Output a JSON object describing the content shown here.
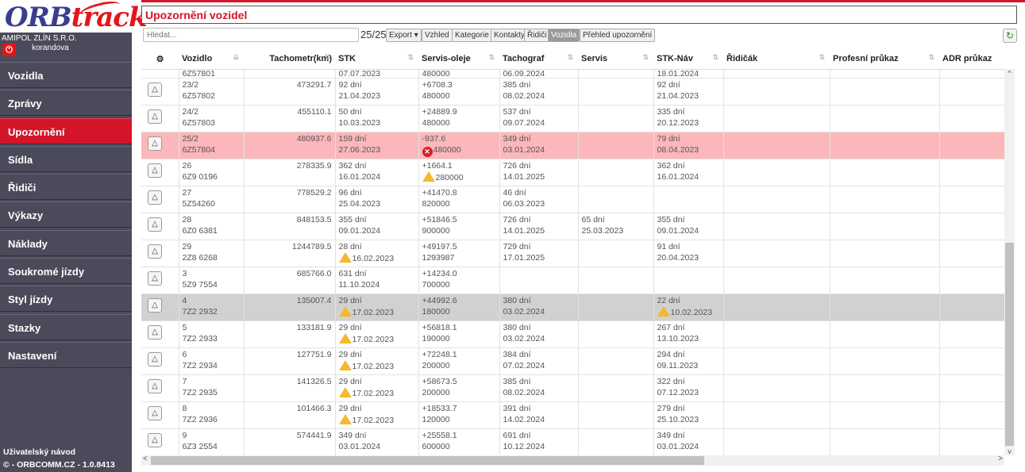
{
  "sidebar": {
    "logo_main": "ORB",
    "logo_accent": "track",
    "company": "AMIPOL ZLÍN S.R.O.",
    "user": "korandova",
    "items": [
      {
        "label": "Vozidla"
      },
      {
        "label": "Zprávy"
      },
      {
        "label": "Upozornění"
      },
      {
        "label": "Sídla"
      },
      {
        "label": "Řidiči"
      },
      {
        "label": "Výkazy"
      },
      {
        "label": "Náklady"
      },
      {
        "label": "Soukromé jízdy"
      },
      {
        "label": "Styl jízdy"
      },
      {
        "label": "Stazky"
      },
      {
        "label": "Nastavení"
      }
    ],
    "active_item": "Upozornění",
    "footer_help": "Uživatelský návod",
    "footer_version": "© - ORBCOMM.CZ - 1.0.8413"
  },
  "header": {
    "title": "Upozornění vozidel"
  },
  "toolbar": {
    "search_placeholder": "Hledat...",
    "count": "25/25",
    "export": "Export ▾",
    "view": "Vzhled",
    "kategorie": "Kategorie",
    "kontakty": "Kontakty",
    "ridici": "Řidiči",
    "vozidla": "Vozidla",
    "prehled": "Přehled upozornění"
  },
  "columns": [
    "Vozidlo",
    "Tachometr(km)",
    "STK",
    "Servis-oleje",
    "Tachograf",
    "Servis",
    "STK-Náv",
    "Řidičák",
    "Profesní průkaz",
    "ADR průkaz"
  ],
  "partial_row": {
    "vozidlo": "6Z57801",
    "stk": "07.07.2023",
    "servis": "480000",
    "tacho": "06.09.2024",
    "nav": "18.01.2024"
  },
  "rows": [
    {
      "v1": "23/2",
      "v2": "6Z57802",
      "km": "473291.7",
      "stk1": "92 dní",
      "stk2": "21.04.2023",
      "stk_warn": false,
      "s1": "+6708.3",
      "s2": "480000",
      "s_warn": "",
      "t1": "385 dní",
      "t2": "08.02.2024",
      "sv1": "",
      "sv2": "",
      "n1": "92 dní",
      "n2": "21.04.2023",
      "n_warn": false,
      "style": ""
    },
    {
      "v1": "24/2",
      "v2": "6Z57803",
      "km": "455110.1",
      "stk1": "50 dní",
      "stk2": "10.03.2023",
      "stk_warn": false,
      "s1": "+24889.9",
      "s2": "480000",
      "s_warn": "",
      "t1": "537 dní",
      "t2": "09.07.2024",
      "sv1": "",
      "sv2": "",
      "n1": "335 dní",
      "n2": "20.12.2023",
      "n_warn": false,
      "style": ""
    },
    {
      "v1": "25/2",
      "v2": "6Z57804",
      "km": "480937.6",
      "stk1": "159 dní",
      "stk2": "27.06.2023",
      "stk_warn": false,
      "s1": "-937.6",
      "s2": "480000",
      "s_warn": "err",
      "t1": "349 dní",
      "t2": "03.01.2024",
      "sv1": "",
      "sv2": "",
      "n1": "79 dní",
      "n2": "08.04.2023",
      "n_warn": false,
      "style": "red"
    },
    {
      "v1": "26",
      "v2": "6Z9 0196",
      "km": "278335.9",
      "stk1": "362 dní",
      "stk2": "16.01.2024",
      "stk_warn": false,
      "s1": "+1664.1",
      "s2": "280000",
      "s_warn": "warn",
      "t1": "726 dní",
      "t2": "14.01.2025",
      "sv1": "",
      "sv2": "",
      "n1": "362 dní",
      "n2": "16.01.2024",
      "n_warn": false,
      "style": ""
    },
    {
      "v1": "27",
      "v2": "5Z54260",
      "km": "778529.2",
      "stk1": "96 dní",
      "stk2": "25.04.2023",
      "stk_warn": false,
      "s1": "+41470.8",
      "s2": "820000",
      "s_warn": "",
      "t1": "46 dní",
      "t2": "06.03.2023",
      "sv1": "",
      "sv2": "",
      "n1": "",
      "n2": "",
      "n_warn": false,
      "style": ""
    },
    {
      "v1": "28",
      "v2": "6Z0 6381",
      "km": "848153.5",
      "stk1": "355 dní",
      "stk2": "09.01.2024",
      "stk_warn": false,
      "s1": "+51846.5",
      "s2": "900000",
      "s_warn": "",
      "t1": "726 dní",
      "t2": "14.01.2025",
      "sv1": "65 dní",
      "sv2": "25.03.2023",
      "n1": "355 dní",
      "n2": "09.01.2024",
      "n_warn": false,
      "style": ""
    },
    {
      "v1": "29",
      "v2": "2Z8 6268",
      "km": "1244789.5",
      "stk1": "28 dní",
      "stk2": "16.02.2023",
      "stk_warn": true,
      "s1": "+49197.5",
      "s2": "1293987",
      "s_warn": "",
      "t1": "729 dní",
      "t2": "17.01.2025",
      "sv1": "",
      "sv2": "",
      "n1": "91 dní",
      "n2": "20.04.2023",
      "n_warn": false,
      "style": ""
    },
    {
      "v1": "3",
      "v2": "5Z9 7554",
      "km": "685766.0",
      "stk1": "631 dní",
      "stk2": "11.10.2024",
      "stk_warn": false,
      "s1": "+14234.0",
      "s2": "700000",
      "s_warn": "",
      "t1": "",
      "t2": "",
      "sv1": "",
      "sv2": "",
      "n1": "",
      "n2": "",
      "n_warn": false,
      "style": ""
    },
    {
      "v1": "4",
      "v2": "7Z2 2932",
      "km": "135007.4",
      "stk1": "29 dní",
      "stk2": "17.02.2023",
      "stk_warn": true,
      "s1": "+44992.6",
      "s2": "180000",
      "s_warn": "",
      "t1": "380 dní",
      "t2": "03.02.2024",
      "sv1": "",
      "sv2": "",
      "n1": "22 dní",
      "n2": "10.02.2023",
      "n_warn": true,
      "style": "grey"
    },
    {
      "v1": "5",
      "v2": "7Z2 2933",
      "km": "133181.9",
      "stk1": "29 dní",
      "stk2": "17.02.2023",
      "stk_warn": true,
      "s1": "+56818.1",
      "s2": "190000",
      "s_warn": "",
      "t1": "380 dní",
      "t2": "03.02.2024",
      "sv1": "",
      "sv2": "",
      "n1": "267 dní",
      "n2": "13.10.2023",
      "n_warn": false,
      "style": ""
    },
    {
      "v1": "6",
      "v2": "7Z2 2934",
      "km": "127751.9",
      "stk1": "29 dní",
      "stk2": "17.02.2023",
      "stk_warn": true,
      "s1": "+72248.1",
      "s2": "200000",
      "s_warn": "",
      "t1": "384 dní",
      "t2": "07.02.2024",
      "sv1": "",
      "sv2": "",
      "n1": "294 dní",
      "n2": "09.11.2023",
      "n_warn": false,
      "style": ""
    },
    {
      "v1": "7",
      "v2": "7Z2 2935",
      "km": "141326.5",
      "stk1": "29 dní",
      "stk2": "17.02.2023",
      "stk_warn": true,
      "s1": "+58673.5",
      "s2": "200000",
      "s_warn": "",
      "t1": "385 dní",
      "t2": "08.02.2024",
      "sv1": "",
      "sv2": "",
      "n1": "322 dní",
      "n2": "07.12.2023",
      "n_warn": false,
      "style": ""
    },
    {
      "v1": "8",
      "v2": "7Z2 2936",
      "km": "101466.3",
      "stk1": "29 dní",
      "stk2": "17.02.2023",
      "stk_warn": true,
      "s1": "+18533.7",
      "s2": "120000",
      "s_warn": "",
      "t1": "391 dní",
      "t2": "14.02.2024",
      "sv1": "",
      "sv2": "",
      "n1": "279 dní",
      "n2": "25.10.2023",
      "n_warn": false,
      "style": ""
    },
    {
      "v1": "9",
      "v2": "6Z3 2554",
      "km": "574441.9",
      "stk1": "349 dní",
      "stk2": "03.01.2024",
      "stk_warn": false,
      "s1": "+25558.1",
      "s2": "600000",
      "s_warn": "",
      "t1": "691 dní",
      "t2": "10.12.2024",
      "sv1": "",
      "sv2": "",
      "n1": "349 dní",
      "n2": "03.01.2024",
      "n_warn": false,
      "style": ""
    }
  ],
  "colors": {
    "accent": "#d3152a",
    "sidebar": "#4b4a5a",
    "row_alert": "#fcb7bb",
    "row_selected": "#d1d1d1",
    "warning": "#f5b82e"
  }
}
